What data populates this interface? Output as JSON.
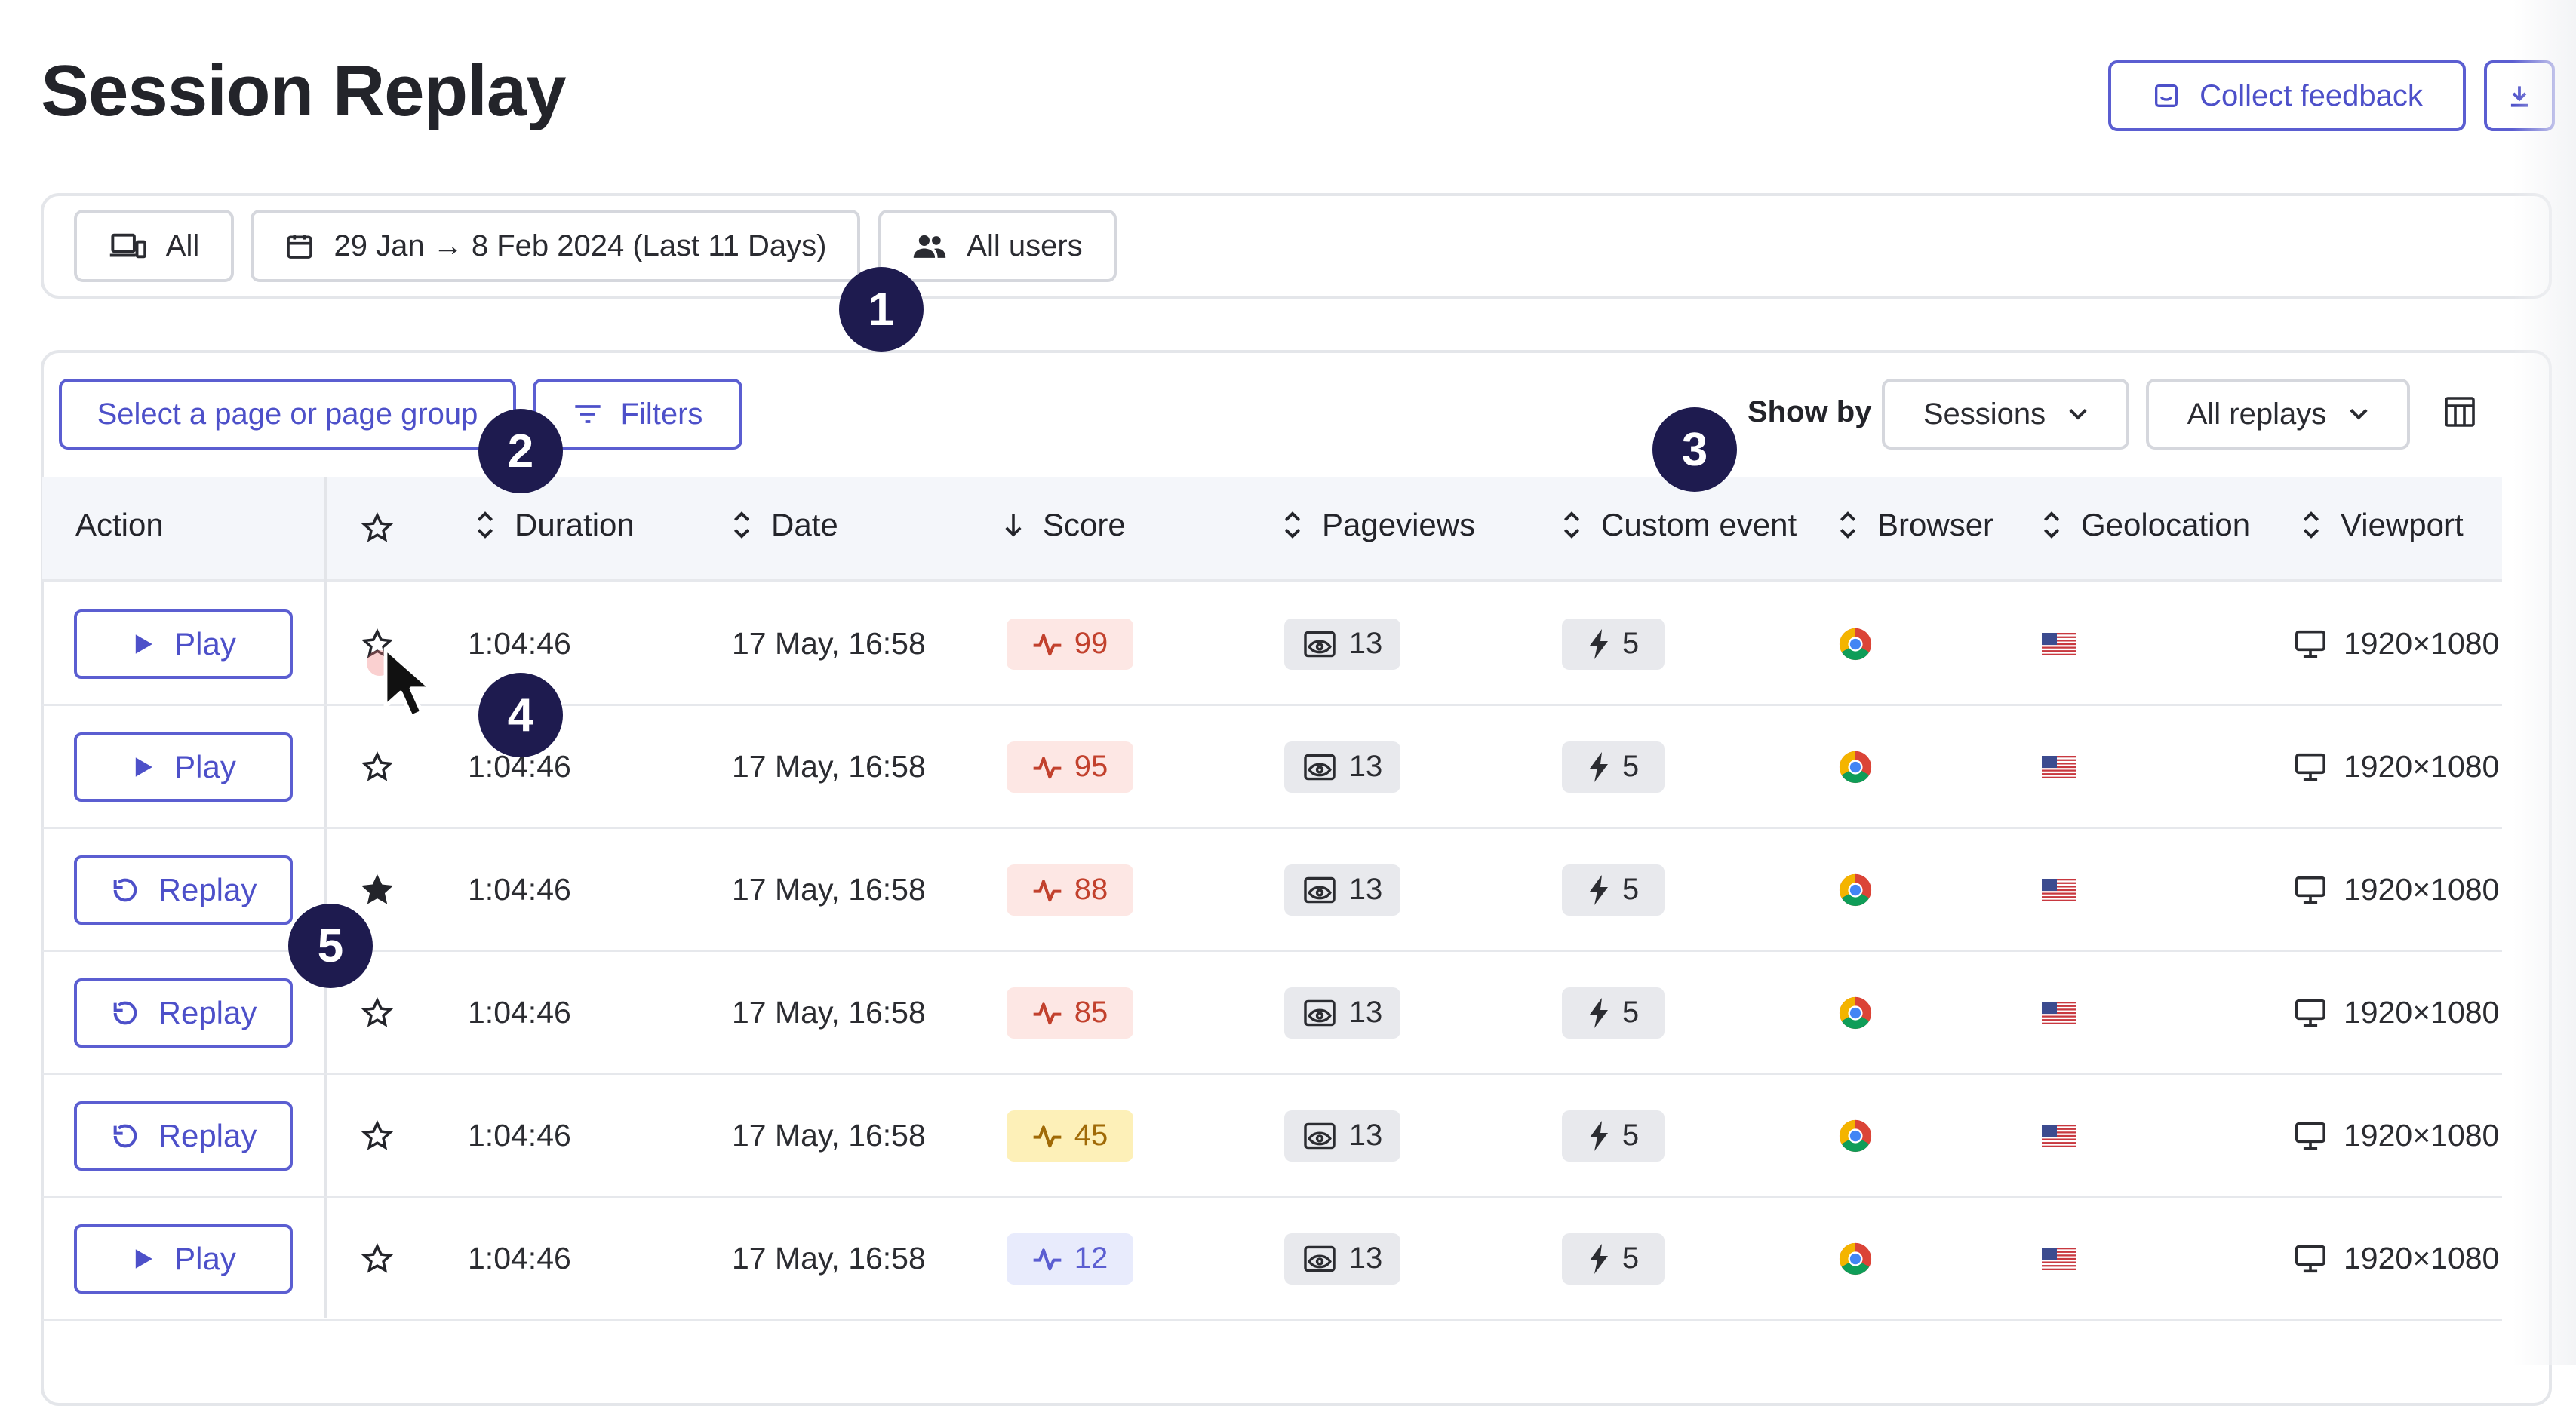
{
  "page": {
    "title": "Session Replay"
  },
  "header_actions": {
    "collect_feedback": "Collect feedback"
  },
  "filter_bar": {
    "device": "All",
    "date_range": "29 Jan → 8 Feb 2024 (Last 11 Days)",
    "users": "All users"
  },
  "toolbar": {
    "page_select": "Select a page or page group",
    "filters": "Filters",
    "show_by_label": "Show by",
    "show_by_value": "Sessions",
    "replays_value": "All replays"
  },
  "columns": {
    "action": "Action",
    "duration": "Duration",
    "date": "Date",
    "score": "Score",
    "pageviews": "Pageviews",
    "custom_event": "Custom event",
    "browser": "Browser",
    "geolocation": "Geolocation",
    "viewport": "Viewport"
  },
  "badges": [
    "1",
    "2",
    "3",
    "4",
    "5"
  ],
  "rows": [
    {
      "action": "Play",
      "action_icon": "play-icon",
      "starred": false,
      "duration": "1:04:46",
      "date": "17 May, 16:58",
      "score": "99",
      "score_level": "high",
      "pageviews": "13",
      "custom_events": "5",
      "browser_icon": "chrome-icon",
      "geo_icon": "us-flag-icon",
      "viewport": "1920×1080"
    },
    {
      "action": "Play",
      "action_icon": "play-icon",
      "starred": false,
      "duration": "1:04:46",
      "date": "17 May, 16:58",
      "score": "95",
      "score_level": "high",
      "pageviews": "13",
      "custom_events": "5",
      "browser_icon": "chrome-icon",
      "geo_icon": "us-flag-icon",
      "viewport": "1920×1080"
    },
    {
      "action": "Replay",
      "action_icon": "replay-icon",
      "starred": true,
      "duration": "1:04:46",
      "date": "17 May, 16:58",
      "score": "88",
      "score_level": "high",
      "pageviews": "13",
      "custom_events": "5",
      "browser_icon": "chrome-icon",
      "geo_icon": "us-flag-icon",
      "viewport": "1920×1080"
    },
    {
      "action": "Replay",
      "action_icon": "replay-icon",
      "starred": false,
      "duration": "1:04:46",
      "date": "17 May, 16:58",
      "score": "85",
      "score_level": "high",
      "pageviews": "13",
      "custom_events": "5",
      "browser_icon": "chrome-icon",
      "geo_icon": "us-flag-icon",
      "viewport": "1920×1080"
    },
    {
      "action": "Replay",
      "action_icon": "replay-icon",
      "starred": false,
      "duration": "1:04:46",
      "date": "17 May, 16:58",
      "score": "45",
      "score_level": "medium",
      "pageviews": "13",
      "custom_events": "5",
      "browser_icon": "chrome-icon",
      "geo_icon": "us-flag-icon",
      "viewport": "1920×1080"
    },
    {
      "action": "Play",
      "action_icon": "play-icon",
      "starred": false,
      "duration": "1:04:46",
      "date": "17 May, 16:58",
      "score": "12",
      "score_level": "low",
      "pageviews": "13",
      "custom_events": "5",
      "browser_icon": "chrome-icon",
      "geo_icon": "us-flag-icon",
      "viewport": "1920×1080"
    }
  ],
  "colors": {
    "accent": "#5b5ed1",
    "badge": "#1e1b4f",
    "score_high_bg": "#fde7e4",
    "score_high_fg": "#c2412d",
    "score_medium_bg": "#fdf0b8",
    "score_medium_fg": "#a06a07",
    "score_low_bg": "#e8ebfc",
    "score_low_fg": "#5b5ed1"
  }
}
